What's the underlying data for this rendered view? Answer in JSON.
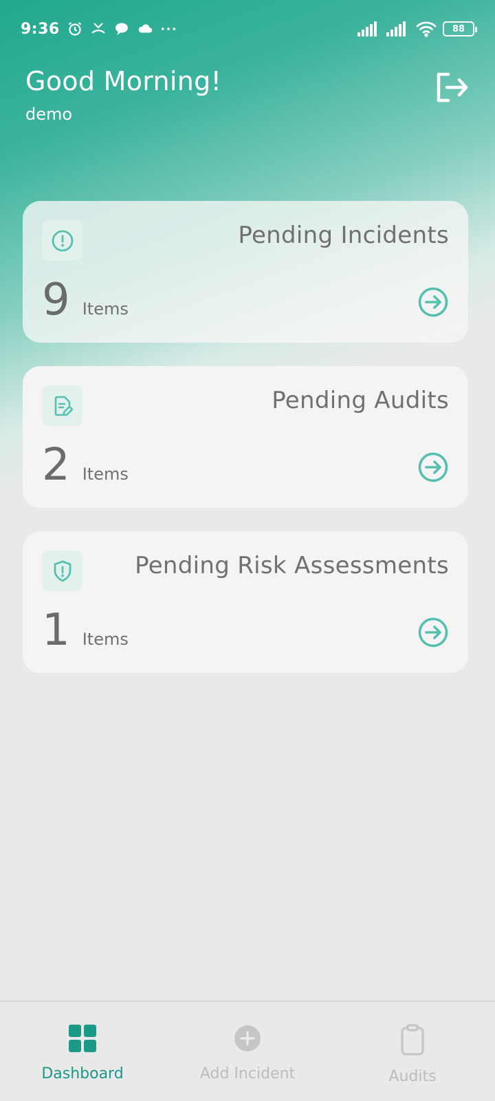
{
  "status_bar": {
    "time": "9:36",
    "battery": "88",
    "icons": [
      "alarm-icon",
      "missed-call-icon",
      "chat-bubble-icon",
      "cloud-icon",
      "more-dots-icon",
      "signal-icon",
      "signal-icon",
      "wifi-icon",
      "battery-icon"
    ]
  },
  "header": {
    "greeting": "Good Morning!",
    "username": "demo",
    "logout_icon": "logout-icon"
  },
  "cards": [
    {
      "title": "Pending Incidents",
      "count": "9",
      "unit": "Items",
      "icon": "alert-circle-icon"
    },
    {
      "title": "Pending Audits",
      "count": "2",
      "unit": "Items",
      "icon": "document-edit-icon"
    },
    {
      "title": "Pending Risk Assessments",
      "count": "1",
      "unit": "Items",
      "icon": "shield-alert-icon"
    }
  ],
  "bottom_nav": {
    "items": [
      {
        "label": "Dashboard",
        "icon": "grid-icon",
        "active": true
      },
      {
        "label": "Add Incident",
        "icon": "plus-circle-icon",
        "active": false
      },
      {
        "label": "Audits",
        "icon": "clipboard-icon",
        "active": false
      }
    ]
  },
  "colors": {
    "accent": "#1a9a86",
    "icon_teal": "#55bfb0",
    "gradient_top": "#22a88f",
    "background": "#e9e9e9",
    "card": "#f4f4f4",
    "text": "#707070",
    "inactive": "#bcbcbc"
  }
}
